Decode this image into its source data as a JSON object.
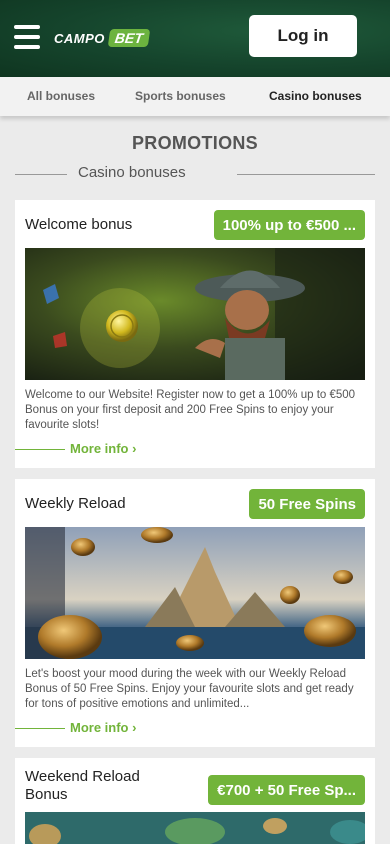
{
  "header": {
    "logo_part1": "CAMPO",
    "logo_part2": "BET",
    "login_label": "Log in",
    "brand_color": "#6cb33f",
    "icons": [
      "hamburger-menu-icon"
    ]
  },
  "tabs": [
    {
      "label": "All bonuses",
      "active": false
    },
    {
      "label": "Sports bonuses",
      "active": false
    },
    {
      "label": "Casino bonuses",
      "active": true
    }
  ],
  "page_title": "PROMOTIONS",
  "section_heading": "Casino bonuses",
  "cards": [
    {
      "title": "Welcome bonus",
      "badge": "100% up to €500 ...",
      "description": "Welcome to our Website! Register now to get a 100% up to €500 Bonus on your first deposit and 200 Free Spins to enjoy your favourite slots!",
      "more": "More info ›"
    },
    {
      "title": "Weekly Reload",
      "badge": "50 Free Spins",
      "description": "Let's boost your mood during the week with our Weekly Reload Bonus of 50 Free Spins. Enjoy your favourite slots and get ready for tons of positive emotions and unlimited...",
      "more": "More info ›"
    },
    {
      "title": "Weekend Reload Bonus",
      "badge": "€700 + 50 Free Sp...",
      "description": "",
      "more": ""
    }
  ]
}
